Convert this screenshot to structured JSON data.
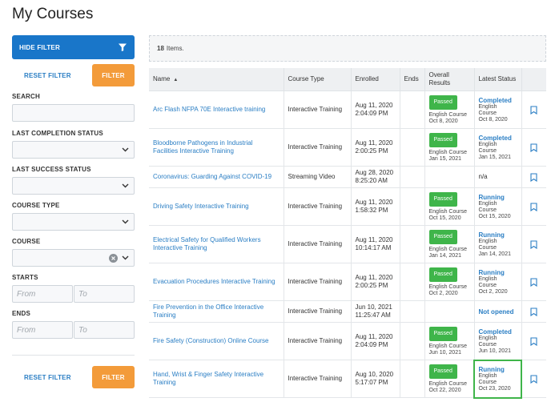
{
  "page": {
    "title": "My Courses"
  },
  "sidebar": {
    "hide_filter_label": "HIDE FILTER",
    "reset_filter_label": "RESET FILTER",
    "filter_label": "FILTER",
    "search_label": "SEARCH",
    "last_completion_label": "LAST COMPLETION STATUS",
    "last_success_label": "LAST SUCCESS STATUS",
    "course_type_label": "COURSE TYPE",
    "course_label": "COURSE",
    "starts_label": "STARTS",
    "ends_label": "ENDS",
    "from_placeholder": "From",
    "to_placeholder": "To"
  },
  "main": {
    "items_count": "18",
    "items_suffix": "Items.",
    "headers": {
      "name": "Name",
      "course_type": "Course Type",
      "enrolled": "Enrolled",
      "ends": "Ends",
      "overall_results": "Overall Results",
      "latest_status": "Latest Status"
    },
    "rows": [
      {
        "name": "Arc Flash NFPA 70E Interactive training",
        "type": "Interactive Training",
        "enrolled_date": "Aug 11, 2020",
        "enrolled_time": "2:04:09 PM",
        "ends": "",
        "result": "Passed",
        "result_lang": "English Course",
        "result_date": "Oct 8, 2020",
        "status": "Completed",
        "status_lang1": "English",
        "status_lang2": "Course",
        "status_date": "Oct 8, 2020"
      },
      {
        "name": "Bloodborne Pathogens in Industrial Facilities Interactive Training",
        "type": "Interactive Training",
        "enrolled_date": "Aug 11, 2020",
        "enrolled_time": "2:00:25 PM",
        "ends": "",
        "result": "Passed",
        "result_lang": "English Course",
        "result_date": "Jan 15, 2021",
        "status": "Completed",
        "status_lang1": "English",
        "status_lang2": "Course",
        "status_date": "Jan 15, 2021"
      },
      {
        "name": "Coronavirus: Guarding Against COVID-19",
        "type": "Streaming Video",
        "enrolled_date": "Aug 28, 2020",
        "enrolled_time": "8:25:20 AM",
        "ends": "",
        "result": "",
        "result_lang": "",
        "result_date": "",
        "status_plain": "n/a"
      },
      {
        "name": "Driving Safety Interactive Training",
        "type": "Interactive Training",
        "enrolled_date": "Aug 11, 2020",
        "enrolled_time": "1:58:32 PM",
        "ends": "",
        "result": "Passed",
        "result_lang": "English Course",
        "result_date": "Oct 15, 2020",
        "status": "Running",
        "status_lang1": "English",
        "status_lang2": "Course",
        "status_date": "Oct 15, 2020"
      },
      {
        "name": "Electrical Safety for Qualified Workers Interactive Training",
        "type": "Interactive Training",
        "enrolled_date": "Aug 11, 2020",
        "enrolled_time": "10:14:17 AM",
        "ends": "",
        "result": "Passed",
        "result_lang": "English Course",
        "result_date": "Jan 14, 2021",
        "status": "Running",
        "status_lang1": "English",
        "status_lang2": "Course",
        "status_date": "Jan 14, 2021"
      },
      {
        "name": "Evacuation Procedures Interactive Training",
        "type": "Interactive Training",
        "enrolled_date": "Aug 11, 2020",
        "enrolled_time": "2:00:25 PM",
        "ends": "",
        "result": "Passed",
        "result_lang": "English Course",
        "result_date": "Oct 2, 2020",
        "status": "Running",
        "status_lang1": "English",
        "status_lang2": "Course",
        "status_date": "Oct 2, 2020"
      },
      {
        "name": "Fire Prevention in the Office Interactive Training",
        "type": "Interactive Training",
        "enrolled_date": "Jun 10, 2021",
        "enrolled_time": "11:25:47 AM",
        "ends": "",
        "result": "",
        "result_lang": "",
        "result_date": "",
        "status": "Not opened"
      },
      {
        "name": "Fire Safety (Construction) Online Course",
        "type": "Interactive Training",
        "enrolled_date": "Aug 11, 2020",
        "enrolled_time": "2:04:09 PM",
        "ends": "",
        "result": "Passed",
        "result_lang": "English Course",
        "result_date": "Jun 10, 2021",
        "status": "Completed",
        "status_lang1": "English",
        "status_lang2": "Course",
        "status_date": "Jun 10, 2021"
      },
      {
        "name": "Hand, Wrist & Finger Safety Interactive Training",
        "type": "Interactive Training",
        "enrolled_date": "Aug 10, 2020",
        "enrolled_time": "5:17:07 PM",
        "ends": "",
        "result": "Passed",
        "result_lang": "English Course",
        "result_date": "Oct 22, 2020",
        "status": "Running",
        "status_lang1": "English",
        "status_lang2": "Course",
        "status_date": "Oct 23, 2020"
      }
    ]
  },
  "colors": {
    "primary": "#1976c9",
    "accent": "#f39b3a",
    "passed": "#3fb54a",
    "link": "#2a7ec4"
  },
  "icons": {
    "filter": "funnel-icon",
    "bookmark": "bookmark-icon",
    "chevron": "chevron-down-icon",
    "clear": "clear-icon"
  }
}
